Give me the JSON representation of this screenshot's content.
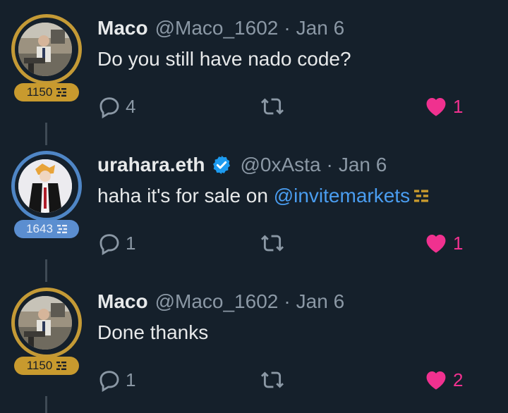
{
  "tweets": [
    {
      "name": "Maco",
      "handle": "@Maco_1602",
      "separator": "·",
      "date": "Jan 6",
      "text": "Do you still have nado code?",
      "mention": "",
      "score": "1150",
      "ring_color": "#c49a36",
      "verified": false,
      "reply_count": "4",
      "like_count": "1"
    },
    {
      "name": "urahara.eth",
      "handle": "@0xAsta",
      "separator": "·",
      "date": "Jan 6",
      "text": "haha it's for sale on ",
      "mention": "@invitemarkets",
      "score": "1643",
      "ring_color": "#4f86c6",
      "verified": true,
      "reply_count": "1",
      "like_count": "1"
    },
    {
      "name": "Maco",
      "handle": "@Maco_1602",
      "separator": "·",
      "date": "Jan 6",
      "text": "Done thanks",
      "mention": "",
      "score": "1150",
      "ring_color": "#c49a36",
      "verified": false,
      "reply_count": "1",
      "like_count": "2"
    }
  ],
  "colors": {
    "background": "#15202b",
    "like": "#f0318f",
    "mention": "#4a9df0",
    "muted": "#8b98a5",
    "score_gold": "#c89a2e",
    "score_blue": "#5b8ed0"
  },
  "icons": [
    "reply-icon",
    "retweet-icon",
    "heart-icon",
    "verified-badge-icon",
    "score-bars-icon"
  ]
}
